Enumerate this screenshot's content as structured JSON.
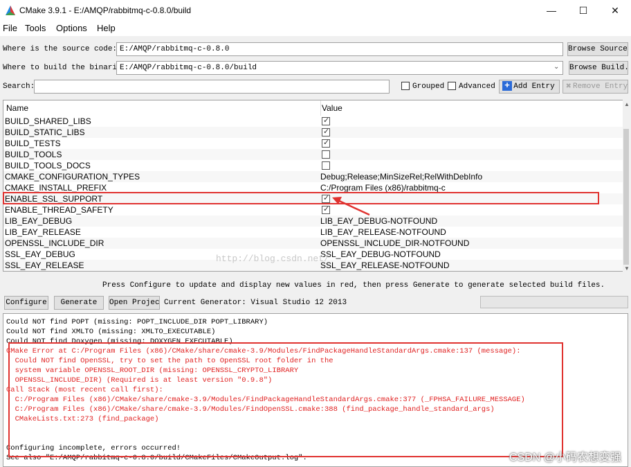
{
  "window": {
    "title": "CMake 3.9.1 - E:/AMQP/rabbitmq-c-0.8.0/build",
    "minimize": "—",
    "maximize": "☐",
    "close": "✕"
  },
  "menu": {
    "file": "File",
    "tools": "Tools",
    "options": "Options",
    "help": "Help"
  },
  "source": {
    "label": "Where is the source code:",
    "value": "E:/AMQP/rabbitmq-c-0.8.0",
    "browse": "Browse Source..."
  },
  "binaries": {
    "label": "Where to build the binaries:",
    "value": "E:/AMQP/rabbitmq-c-0.8.0/build",
    "browse": "Browse Build..."
  },
  "search": {
    "label": "Search:",
    "value": ""
  },
  "toolbar": {
    "grouped": "Grouped",
    "advanced": "Advanced",
    "add_entry": "Add Entry",
    "remove_entry": "Remove Entry"
  },
  "table": {
    "col_name": "Name",
    "col_value": "Value",
    "rows": [
      {
        "name": "BUILD_SHARED_LIBS",
        "value": "",
        "checked": true
      },
      {
        "name": "BUILD_STATIC_LIBS",
        "value": "",
        "checked": true
      },
      {
        "name": "BUILD_TESTS",
        "value": "",
        "checked": true
      },
      {
        "name": "BUILD_TOOLS",
        "value": "",
        "checked": false
      },
      {
        "name": "BUILD_TOOLS_DOCS",
        "value": "",
        "checked": false
      },
      {
        "name": "CMAKE_CONFIGURATION_TYPES",
        "value": "Debug;Release;MinSizeRel;RelWithDebInfo"
      },
      {
        "name": "CMAKE_INSTALL_PREFIX",
        "value": "C:/Program Files (x86)/rabbitmq-c"
      },
      {
        "name": "ENABLE_SSL_SUPPORT",
        "value": "",
        "checked": true
      },
      {
        "name": "ENABLE_THREAD_SAFETY",
        "value": "",
        "checked": true
      },
      {
        "name": "LIB_EAY_DEBUG",
        "value": "LIB_EAY_DEBUG-NOTFOUND"
      },
      {
        "name": "LIB_EAY_RELEASE",
        "value": "LIB_EAY_RELEASE-NOTFOUND"
      },
      {
        "name": "OPENSSL_INCLUDE_DIR",
        "value": "OPENSSL_INCLUDE_DIR-NOTFOUND"
      },
      {
        "name": "SSL_EAY_DEBUG",
        "value": "SSL_EAY_DEBUG-NOTFOUND"
      },
      {
        "name": "SSL_EAY_RELEASE",
        "value": "SSL_EAY_RELEASE-NOTFOUND"
      }
    ]
  },
  "hint": "Press Configure to update and display new values in red, then press Generate to generate selected build files.",
  "actions": {
    "configure": "Configure",
    "generate": "Generate",
    "open_project": "Open Project",
    "current_generator": "Current Generator: Visual Studio 12 2013"
  },
  "output": [
    {
      "text": "Could NOT find POPT (missing: POPT_INCLUDE_DIR POPT_LIBRARY)",
      "red": false
    },
    {
      "text": "Could NOT find XMLTO (missing: XMLTO_EXECUTABLE)",
      "red": false
    },
    {
      "text": "Could NOT find Doxygen (missing: DOXYGEN_EXECUTABLE)",
      "red": false
    },
    {
      "text": "CMake Error at C:/Program Files (x86)/CMake/share/cmake-3.9/Modules/FindPackageHandleStandardArgs.cmake:137 (message):",
      "red": true
    },
    {
      "text": "  Could NOT find OpenSSL, try to set the path to OpenSSL root folder in the",
      "red": true
    },
    {
      "text": "  system variable OPENSSL_ROOT_DIR (missing: OPENSSL_CRYPTO_LIBRARY",
      "red": true
    },
    {
      "text": "  OPENSSL_INCLUDE_DIR) (Required is at least version \"0.9.8\")",
      "red": true
    },
    {
      "text": "Call Stack (most recent call first):",
      "red": true
    },
    {
      "text": "  C:/Program Files (x86)/CMake/share/cmake-3.9/Modules/FindPackageHandleStandardArgs.cmake:377 (_FPHSA_FAILURE_MESSAGE)",
      "red": true
    },
    {
      "text": "  C:/Program Files (x86)/CMake/share/cmake-3.9/Modules/FindOpenSSL.cmake:388 (find_package_handle_standard_args)",
      "red": true
    },
    {
      "text": "  CMakeLists.txt:273 (find_package)",
      "red": true
    },
    {
      "text": "",
      "red": false
    },
    {
      "text": "",
      "red": false
    },
    {
      "text": "Configuring incomplete, errors occurred!",
      "red": false
    },
    {
      "text": "See also \"E:/AMQP/rabbitmq-c-0.8.0/build/CMakeFiles/CMakeOutput.log\".",
      "red": false
    }
  ],
  "watermark": "http://blog.csdn.net/",
  "csdn_credit": "CSDN @小码农想变强",
  "colors": {
    "error_red": "#e02020",
    "highlight_box": "#e0322f"
  }
}
